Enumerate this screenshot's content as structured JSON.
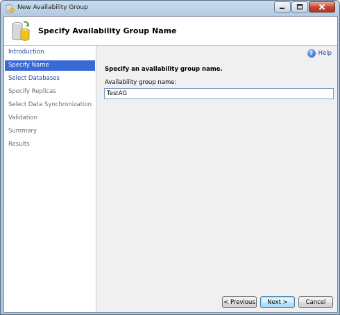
{
  "window": {
    "title": "New Availability Group"
  },
  "header": {
    "title": "Specify Availability Group Name",
    "icon": "database-cylinders-icon"
  },
  "sidebar": {
    "items": [
      {
        "label": "Introduction",
        "state": "link"
      },
      {
        "label": "Specify Name",
        "state": "active"
      },
      {
        "label": "Select Databases",
        "state": "link"
      },
      {
        "label": "Specify Replicas",
        "state": "disabled"
      },
      {
        "label": "Select Data Synchronization",
        "state": "disabled"
      },
      {
        "label": "Validation",
        "state": "disabled"
      },
      {
        "label": "Summary",
        "state": "disabled"
      },
      {
        "label": "Results",
        "state": "disabled"
      }
    ]
  },
  "main": {
    "help_label": "Help",
    "instruction": "Specify an availability group name.",
    "field_label": "Availability group name:",
    "field_value": "TestAG"
  },
  "buttons": {
    "previous": "< Previous",
    "next": "Next >",
    "cancel": "Cancel"
  },
  "colors": {
    "selection": "#3968d7",
    "link": "#1c46a8",
    "disabled_text": "#6d6d6d"
  }
}
